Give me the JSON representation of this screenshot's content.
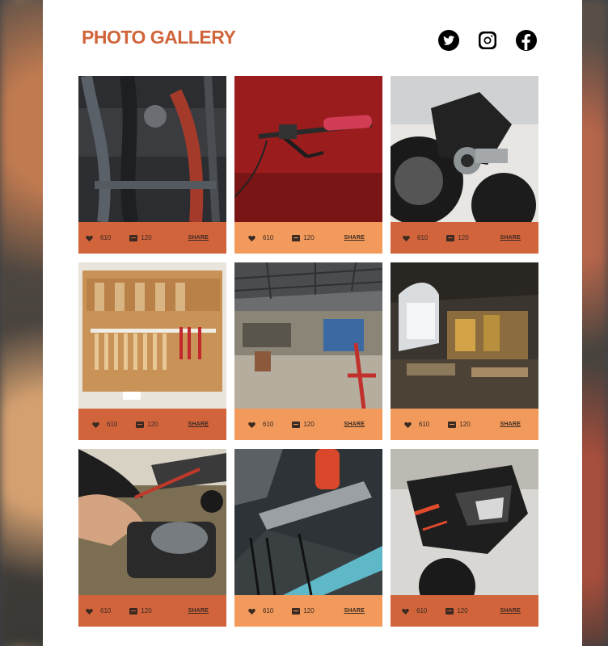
{
  "header": {
    "title": "PHOTO GALLERY"
  },
  "social": [
    "twitter-icon",
    "instagram-icon",
    "facebook-icon"
  ],
  "colors": {
    "accent": "#d0643b",
    "bar_dark": "#d2643c",
    "bar_light": "#f29a5b"
  },
  "cards": [
    {
      "photo": "engine closeup",
      "likes": "610",
      "comments": "120",
      "share": "SHARE"
    },
    {
      "photo": "handlebar grip",
      "likes": "610",
      "comments": "120",
      "share": "SHARE"
    },
    {
      "photo": "motorcycle exhaust",
      "likes": "610",
      "comments": "120",
      "share": "SHARE"
    },
    {
      "photo": "tool wall",
      "likes": "610",
      "comments": "120",
      "share": "SHARE"
    },
    {
      "photo": "workshop garage",
      "likes": "610",
      "comments": "120",
      "share": "SHARE"
    },
    {
      "photo": "workshop interior",
      "likes": "610",
      "comments": "120",
      "share": "SHARE"
    },
    {
      "photo": "mechanic hands",
      "likes": "610",
      "comments": "120",
      "share": "SHARE"
    },
    {
      "photo": "tools closeup",
      "likes": "610",
      "comments": "120",
      "share": "SHARE"
    },
    {
      "photo": "motorcycle tail",
      "likes": "610",
      "comments": "120",
      "share": "SHARE"
    }
  ]
}
